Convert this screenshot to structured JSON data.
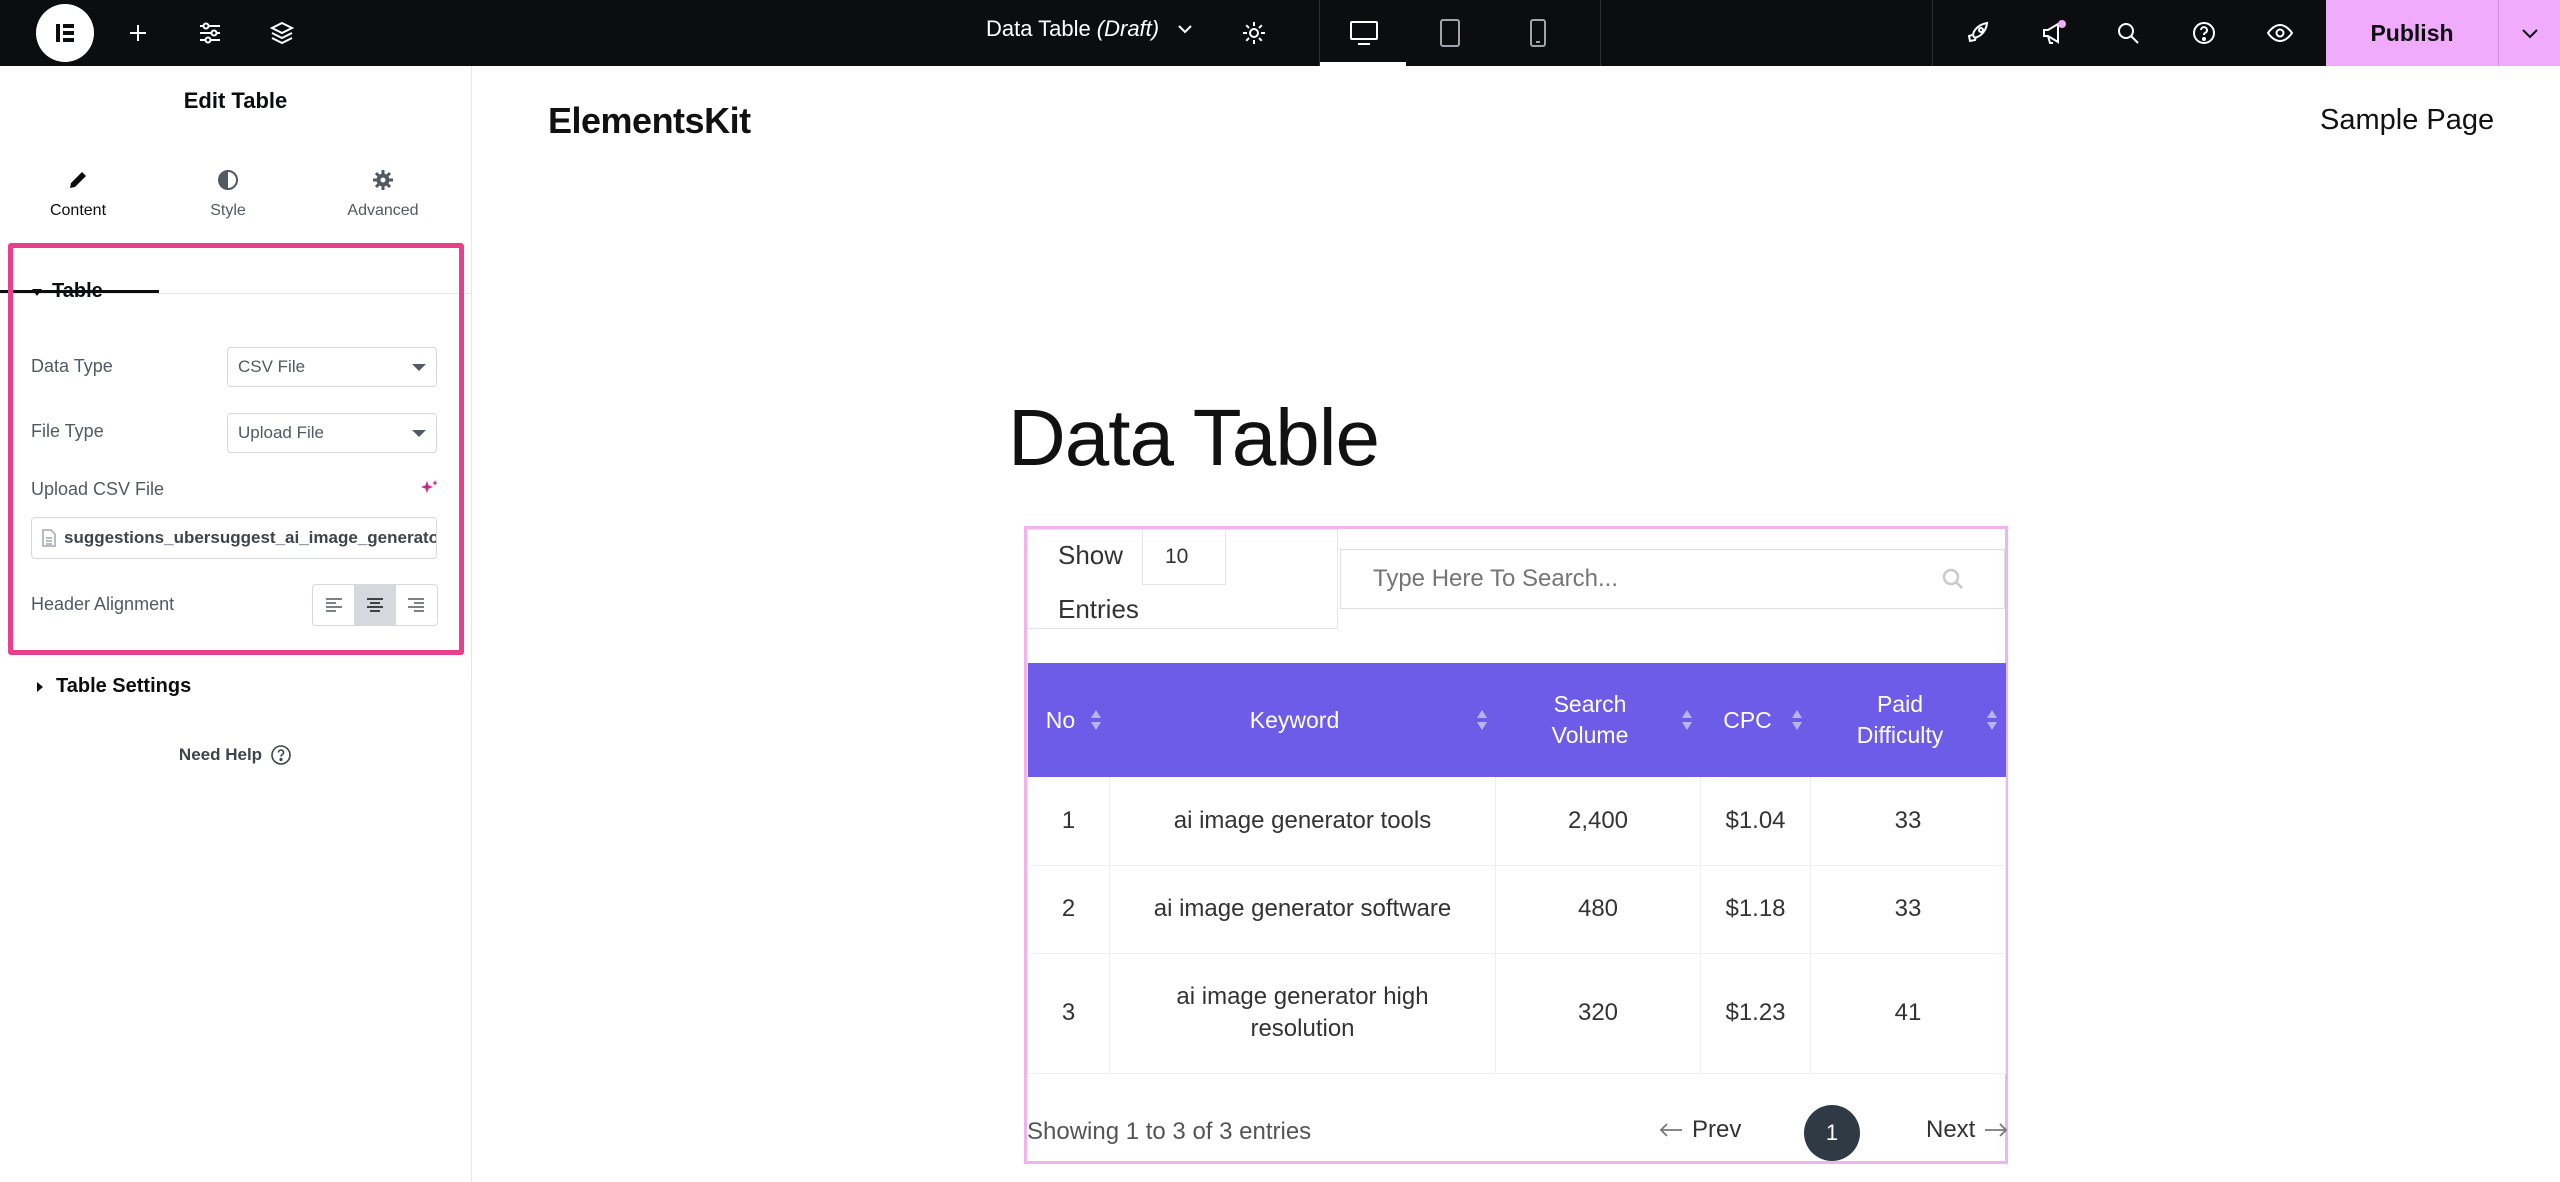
{
  "topbar": {
    "doc_title": "Data Table",
    "doc_status": "(Draft)",
    "publish_label": "Publish"
  },
  "panel": {
    "title": "Edit Table",
    "tabs": [
      {
        "label": "Content",
        "icon": "pencil-icon",
        "active": true
      },
      {
        "label": "Style",
        "icon": "half-circle-icon"
      },
      {
        "label": "Advanced",
        "icon": "gear-icon"
      }
    ],
    "section_table": "Table",
    "data_type_label": "Data Type",
    "data_type_value": "CSV File",
    "file_type_label": "File Type",
    "file_type_value": "Upload File",
    "upload_label": "Upload CSV File",
    "file_name": "suggestions_ubersuggest_ai_image_generator.csv",
    "header_alignment_label": "Header Alignment",
    "header_alignment_value": "center",
    "section_table_settings": "Table Settings",
    "need_help": "Need Help"
  },
  "preview": {
    "brand": "ElementsKit",
    "nav_link": "Sample Page",
    "heading": "Data Table",
    "show_label": "Show",
    "entries_value": "10",
    "entries_label": "Entries",
    "search_placeholder": "Type Here To Search...",
    "table": {
      "headers": [
        "No",
        "Keyword",
        "Search Volume",
        "CPC",
        "Paid Difficulty"
      ],
      "rows": [
        [
          "1",
          "ai image generator tools",
          "2,400",
          "$1.04",
          "33"
        ],
        [
          "2",
          "ai image generator software",
          "480",
          "$1.18",
          "33"
        ],
        [
          "3",
          "ai image generator high resolution",
          "320",
          "$1.23",
          "41"
        ]
      ]
    },
    "info": "Showing 1 to 3 of 3 entries",
    "prev_label": "Prev",
    "current_page": "1",
    "next_label": "Next"
  },
  "colors": {
    "accent_pink": "#e7418e",
    "publish_bg": "#f0abfc",
    "table_header_bg": "#6c5ce7",
    "topbar_bg": "#0c0d0e",
    "active_page_bg": "#2f3a45"
  }
}
